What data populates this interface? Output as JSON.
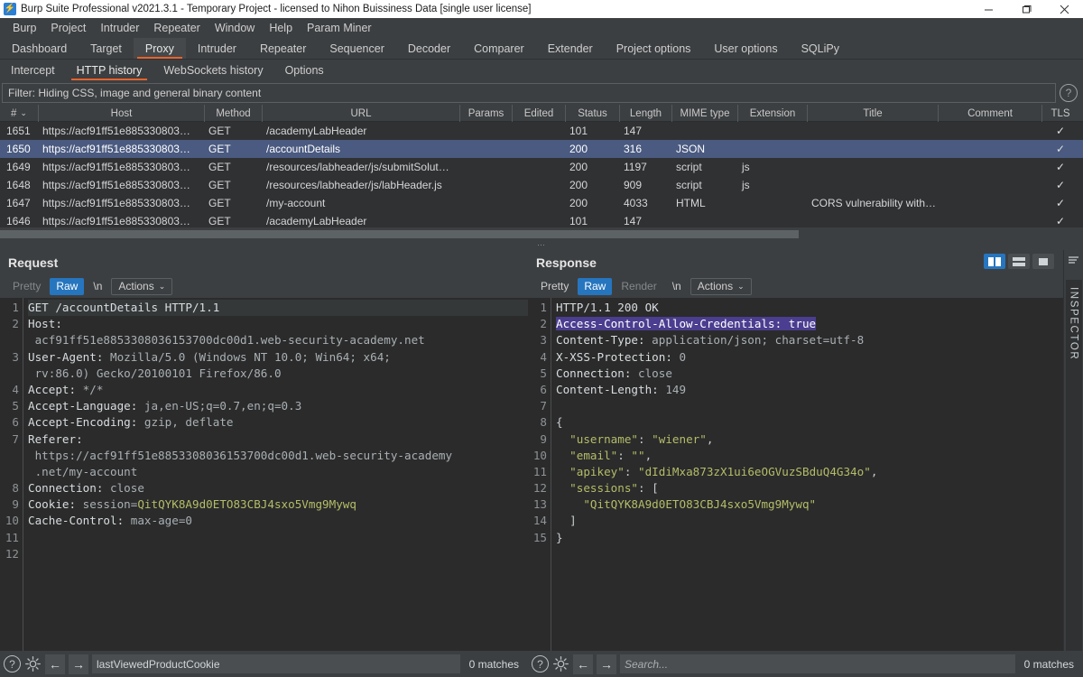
{
  "window": {
    "title": "Burp Suite Professional v2021.3.1 - Temporary Project - licensed to Nihon Buissiness Data [single user license]",
    "minimize": "–",
    "maximize": "❐",
    "close": "✕"
  },
  "menubar": {
    "items": [
      "Burp",
      "Project",
      "Intruder",
      "Repeater",
      "Window",
      "Help",
      "Param Miner"
    ]
  },
  "maintabs": {
    "items": [
      "Dashboard",
      "Target",
      "Proxy",
      "Intruder",
      "Repeater",
      "Sequencer",
      "Decoder",
      "Comparer",
      "Extender",
      "Project options",
      "User options",
      "SQLiPy"
    ],
    "active": "Proxy"
  },
  "subtabs": {
    "items": [
      "Intercept",
      "HTTP history",
      "WebSockets history",
      "Options"
    ],
    "active": "HTTP history"
  },
  "filter": {
    "text": "Filter: Hiding CSS, image and general binary content",
    "help_icon": "?"
  },
  "history": {
    "columns": [
      "#",
      "Host",
      "Method",
      "URL",
      "Params",
      "Edited",
      "Status",
      "Length",
      "MIME type",
      "Extension",
      "Title",
      "Comment",
      "TLS"
    ],
    "sort_indicator": "⌄",
    "rows": [
      {
        "num": "1651",
        "host": "https://acf91ff51e885330803…",
        "method": "GET",
        "url": "/academyLabHeader",
        "params": "",
        "edited": "",
        "status": "101",
        "length": "147",
        "mime": "",
        "ext": "",
        "title": "",
        "comment": "",
        "tls": "✓",
        "selected": false
      },
      {
        "num": "1650",
        "host": "https://acf91ff51e885330803…",
        "method": "GET",
        "url": "/accountDetails",
        "params": "",
        "edited": "",
        "status": "200",
        "length": "316",
        "mime": "JSON",
        "ext": "",
        "title": "",
        "comment": "",
        "tls": "✓",
        "selected": true
      },
      {
        "num": "1649",
        "host": "https://acf91ff51e885330803…",
        "method": "GET",
        "url": "/resources/labheader/js/submitSolut…",
        "params": "",
        "edited": "",
        "status": "200",
        "length": "1197",
        "mime": "script",
        "ext": "js",
        "title": "",
        "comment": "",
        "tls": "✓",
        "selected": false
      },
      {
        "num": "1648",
        "host": "https://acf91ff51e885330803…",
        "method": "GET",
        "url": "/resources/labheader/js/labHeader.js",
        "params": "",
        "edited": "",
        "status": "200",
        "length": "909",
        "mime": "script",
        "ext": "js",
        "title": "",
        "comment": "",
        "tls": "✓",
        "selected": false
      },
      {
        "num": "1647",
        "host": "https://acf91ff51e885330803…",
        "method": "GET",
        "url": "/my-account",
        "params": "",
        "edited": "",
        "status": "200",
        "length": "4033",
        "mime": "HTML",
        "ext": "",
        "title": "CORS vulnerability with…",
        "comment": "",
        "tls": "✓",
        "selected": false
      },
      {
        "num": "1646",
        "host": "https://acf91ff51e885330803…",
        "method": "GET",
        "url": "/academyLabHeader",
        "params": "",
        "edited": "",
        "status": "101",
        "length": "147",
        "mime": "",
        "ext": "",
        "title": "",
        "comment": "",
        "tls": "✓",
        "selected": false
      }
    ]
  },
  "request": {
    "title": "Request",
    "tabs": {
      "pretty": "Pretty",
      "raw": "Raw",
      "newline": "\\n",
      "actions": "Actions",
      "caret": "⌄"
    },
    "active_tab": "Raw",
    "line_numbers": [
      "1",
      "2",
      "",
      "3",
      "",
      "4",
      "5",
      "6",
      "7",
      "",
      "",
      "8",
      "9",
      "10",
      "11",
      "12"
    ],
    "content_lines": [
      "GET /accountDetails HTTP/1.1",
      "Host:",
      " acf91ff51e8853308036153700dc00d1.web-security-academy.net",
      "User-Agent: Mozilla/5.0 (Windows NT 10.0; Win64; x64;",
      " rv:86.0) Gecko/20100101 Firefox/86.0",
      "Accept: */*",
      "Accept-Language: ja,en-US;q=0.7,en;q=0.3",
      "Accept-Encoding: gzip, deflate",
      "Referer:",
      " https://acf91ff51e8853308036153700dc00d1.web-security-academy",
      " .net/my-account",
      "Connection: close",
      "Cookie: session=QitQYK8A9d0ETO83CBJ4sxo5Vmg9Mywq",
      "Cache-Control: max-age=0",
      "",
      ""
    ]
  },
  "response": {
    "title": "Response",
    "tabs": {
      "pretty": "Pretty",
      "raw": "Raw",
      "render": "Render",
      "newline": "\\n",
      "actions": "Actions",
      "caret": "⌄"
    },
    "active_tab": "Raw",
    "line_numbers": [
      "1",
      "2",
      "3",
      "4",
      "5",
      "6",
      "7",
      "8",
      "9",
      "10",
      "11",
      "12",
      "13",
      "14",
      "15"
    ],
    "content_lines": [
      "HTTP/1.1 200 OK",
      "Access-Control-Allow-Credentials: true",
      "Content-Type: application/json; charset=utf-8",
      "X-XSS-Protection: 0",
      "Connection: close",
      "Content-Length: 149",
      "",
      "{",
      "  \"username\": \"wiener\",",
      "  \"email\": \"\",",
      "  \"apikey\": \"dIdiMxa873zX1ui6eOGVuzSBduQ4G34o\",",
      "  \"sessions\": [",
      "    \"QitQYK8A9d0ETO83CBJ4sxo5Vmg9Mywq\"",
      "  ]",
      "}"
    ],
    "highlighted_line": "Access-Control-Allow-Credentials: true"
  },
  "layout_buttons": {
    "side_by_side": "side-by-side-layout",
    "stacked": "stacked-layout",
    "single": "single-pane-layout",
    "active": "side_by_side"
  },
  "inspector": {
    "label": "INSPECTOR",
    "hamburger": "≡"
  },
  "statusbar_left": {
    "help": "?",
    "settings": "gear",
    "back": "←",
    "forward": "→",
    "search_value": "lastViewedProductCookie",
    "matches": "0 matches"
  },
  "statusbar_right": {
    "help": "?",
    "settings": "gear",
    "back": "←",
    "forward": "→",
    "search_placeholder": "Search...",
    "matches": "0 matches"
  },
  "splitter": {
    "grip": "⋯"
  }
}
